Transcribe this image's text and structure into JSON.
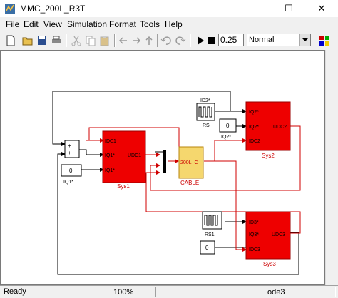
{
  "window": {
    "title": "MMC_200L_R3T"
  },
  "menu": [
    "File",
    "Edit",
    "View",
    "Simulation",
    "Format",
    "Tools",
    "Help"
  ],
  "toolbar": {
    "stop_time": "0.25",
    "sim_mode": "Normal"
  },
  "blocks": {
    "sys1": {
      "name": "Sys1",
      "ports_in": [
        "IDC1",
        "IQ1*",
        "IQ1*"
      ],
      "port_out": "UDC1"
    },
    "sys2": {
      "name": "Sys2",
      "ports_in": [
        "IQ2*",
        "IQ2*",
        "IDC2"
      ],
      "port_out": "UDC2"
    },
    "sys3": {
      "name": "Sys3",
      "ports_in": [
        "ID3*",
        "IQ3*",
        "IDC3"
      ],
      "port_out": "UDC3"
    },
    "cable": {
      "name": "CABLE",
      "label": "200L_C"
    },
    "rs": {
      "name": "RS"
    },
    "rs1": {
      "name": "RS1"
    },
    "id2_label": "ID2*",
    "iq1_label": "IQ1*",
    "iq2_label": "IQ2*",
    "const_iq1": "0",
    "const_iq2": "0",
    "const_sys3": "0"
  },
  "status": {
    "state": "Ready",
    "zoom": "100%",
    "solver": "ode3"
  },
  "colors": {
    "block_red": "#ee0000",
    "cable_yellow": "#f5d76e",
    "signal_red": "#d00000"
  }
}
